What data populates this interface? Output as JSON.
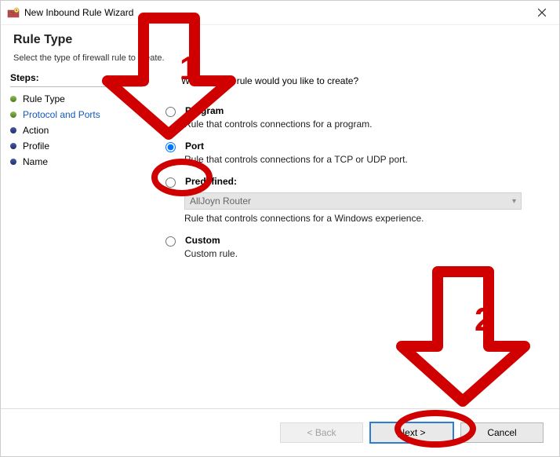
{
  "window": {
    "title": "New Inbound Rule Wizard"
  },
  "header": {
    "title": "Rule Type",
    "subtitle": "Select the type of firewall rule to create."
  },
  "sidebar": {
    "label": "Steps:",
    "steps": [
      {
        "label": "Rule Type",
        "active": false
      },
      {
        "label": "Protocol and Ports",
        "active": true
      },
      {
        "label": "Action",
        "active": false
      },
      {
        "label": "Profile",
        "active": false
      },
      {
        "label": "Name",
        "active": false
      }
    ]
  },
  "main": {
    "question": "What type of rule would you like to create?",
    "options": {
      "program": {
        "label": "Program",
        "desc": "Rule that controls connections for a program."
      },
      "port": {
        "label": "Port",
        "desc": "Rule that controls connections for a TCP or UDP port."
      },
      "predefined": {
        "label": "Predefined:",
        "selected": "AllJoyn Router",
        "desc": "Rule that controls connections for a Windows experience."
      },
      "custom": {
        "label": "Custom",
        "desc": "Custom rule."
      }
    }
  },
  "footer": {
    "back": "< Back",
    "next_prefix": "N",
    "next_rest": "ext >",
    "cancel": "Cancel"
  },
  "annotations": {
    "label1": "1",
    "label2": "2"
  }
}
